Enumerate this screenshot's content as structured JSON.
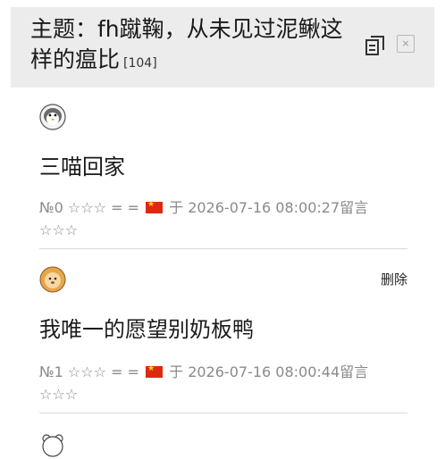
{
  "thread": {
    "title": "主题：fh蹴鞠，从未见过泥鳅这样的瘟比",
    "reply_count": "[104]",
    "close_label": "×"
  },
  "posts": [
    {
      "avatar": "penguin-avatar",
      "content": "三喵回家",
      "meta_prefix": "№0 ☆☆☆ = =",
      "flag": "china-flag",
      "meta_date": "于 2026-07-16 08:00:27",
      "reply_label": "留言",
      "reply_stars": "☆☆☆"
    },
    {
      "avatar": "lion-avatar",
      "delete_label": "删除",
      "content": "我唯一的愿望别奶板鸭",
      "meta_prefix": "№1 ☆☆☆ = =",
      "flag": "china-flag",
      "meta_date": "于 2026-07-16 08:00:44",
      "reply_label": "留言",
      "reply_stars": "☆☆☆"
    },
    {
      "avatar": "bear-avatar"
    }
  ],
  "colors": {
    "header_bg": "#ececec",
    "meta_text": "#8a8a8a",
    "divider": "#dadada"
  }
}
